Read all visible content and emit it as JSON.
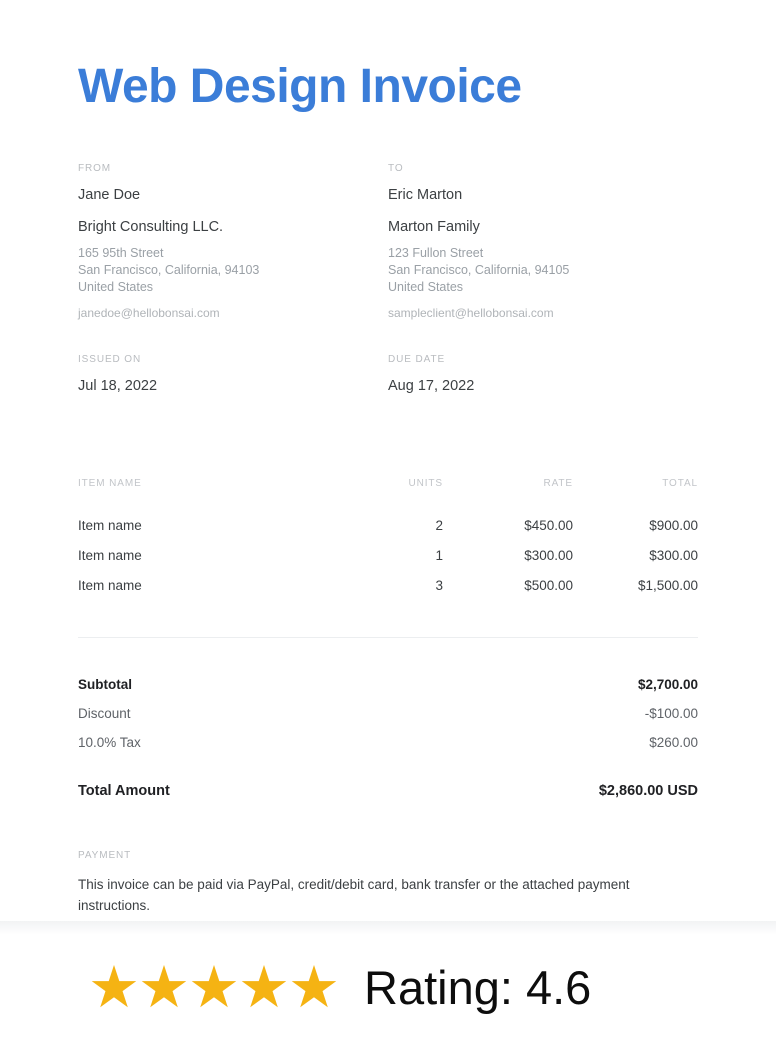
{
  "document": {
    "title": "Web Design Invoice",
    "accent_color": "#3b7dd8"
  },
  "from": {
    "label": "FROM",
    "person": "Jane Doe",
    "company": "Bright Consulting LLC.",
    "address_line1": "165 95th Street",
    "address_line2": "San Francisco, California, 94103",
    "address_line3": "United States",
    "email": "janedoe@hellobonsai.com"
  },
  "to": {
    "label": "TO",
    "person": "Eric Marton",
    "company": "Marton Family",
    "address_line1": "123 Fullon Street",
    "address_line2": "San Francisco, California, 94105",
    "address_line3": "United States",
    "email": "sampleclient@hellobonsai.com"
  },
  "dates": {
    "issued_label": "ISSUED ON",
    "issued_value": "Jul 18, 2022",
    "due_label": "DUE DATE",
    "due_value": "Aug 17, 2022"
  },
  "items_table": {
    "headers": {
      "item": "ITEM NAME",
      "units": "UNITS",
      "rate": "RATE",
      "total": "TOTAL"
    },
    "rows": [
      {
        "item": "Item name",
        "units": "2",
        "rate": "$450.00",
        "total": "$900.00"
      },
      {
        "item": "Item name",
        "units": "1",
        "rate": "$300.00",
        "total": "$300.00"
      },
      {
        "item": "Item name",
        "units": "3",
        "rate": "$500.00",
        "total": "$1,500.00"
      }
    ]
  },
  "totals": {
    "subtotal_label": "Subtotal",
    "subtotal_value": "$2,700.00",
    "discount_label": "Discount",
    "discount_value": "-$100.00",
    "tax_label": "10.0% Tax",
    "tax_value": "$260.00",
    "grand_label": "Total Amount",
    "grand_value": "$2,860.00 USD"
  },
  "payment": {
    "label": "PAYMENT",
    "text": "This invoice can be paid via PayPal, credit/debit card, bank transfer or the attached payment instructions."
  },
  "rating": {
    "stars_filled": 5,
    "star_glyph": "★",
    "star_color": "#f5b313",
    "text": "Rating: 4.6",
    "value": 4.6
  }
}
